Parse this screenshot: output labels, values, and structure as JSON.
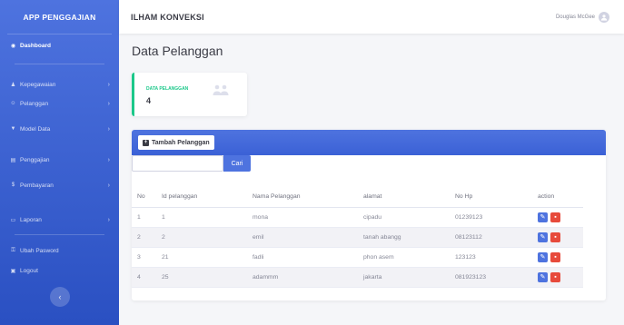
{
  "sidebar": {
    "brand": "APP PENGGAJIAN",
    "items": [
      {
        "label": "Dashboard",
        "icon": "tachometer-icon",
        "glyph": "◉",
        "active": true,
        "has_chevron": false
      },
      {
        "label": "Kepegawaian",
        "icon": "users-icon",
        "glyph": "♟",
        "active": false,
        "has_chevron": true
      },
      {
        "label": "Pelanggan",
        "icon": "user-group-icon",
        "glyph": "☺",
        "active": false,
        "has_chevron": true
      },
      {
        "label": "Model Data",
        "icon": "filter-icon",
        "glyph": "▼",
        "active": false,
        "has_chevron": true
      },
      {
        "label": "Penggajian",
        "icon": "table-icon",
        "glyph": "▤",
        "active": false,
        "has_chevron": true
      },
      {
        "label": "Pembayaran",
        "icon": "dollar-icon",
        "glyph": "$",
        "active": false,
        "has_chevron": true
      },
      {
        "label": "Laporan",
        "icon": "file-icon",
        "glyph": "▭",
        "active": false,
        "has_chevron": true
      },
      {
        "label": "Ubah Pasword",
        "icon": "key-icon",
        "glyph": "⚿",
        "active": false,
        "has_chevron": false
      },
      {
        "label": "Logout",
        "icon": "logout-icon",
        "glyph": "▣",
        "active": false,
        "has_chevron": false
      }
    ],
    "toggle_glyph": "‹"
  },
  "topbar": {
    "title": "ILHAM KONVEKSI",
    "user_name": "Douglas McGee"
  },
  "main": {
    "page_title": "Data Pelanggan",
    "stat": {
      "label": "DATA PELANGGAN",
      "value": "4"
    },
    "add_button": "Tambah Pelanggan",
    "search": {
      "value": "",
      "placeholder": "",
      "button": "Cari"
    },
    "table": {
      "headers": [
        "No",
        "Id pelanggan",
        "Nama Pelanggan",
        "alamat",
        "No Hp",
        "action"
      ],
      "rows": [
        [
          "1",
          "1",
          "mona",
          "cipadu",
          "01239123"
        ],
        [
          "2",
          "2",
          "emil",
          "tanah abangg",
          "08123112"
        ],
        [
          "3",
          "21",
          "fadli",
          "phon asem",
          "123123"
        ],
        [
          "4",
          "25",
          "adammm",
          "jakarta",
          "081923123"
        ]
      ]
    }
  },
  "colors": {
    "sidebar": "#4e73df",
    "success": "#1cc88a",
    "danger": "#e74a3b"
  }
}
